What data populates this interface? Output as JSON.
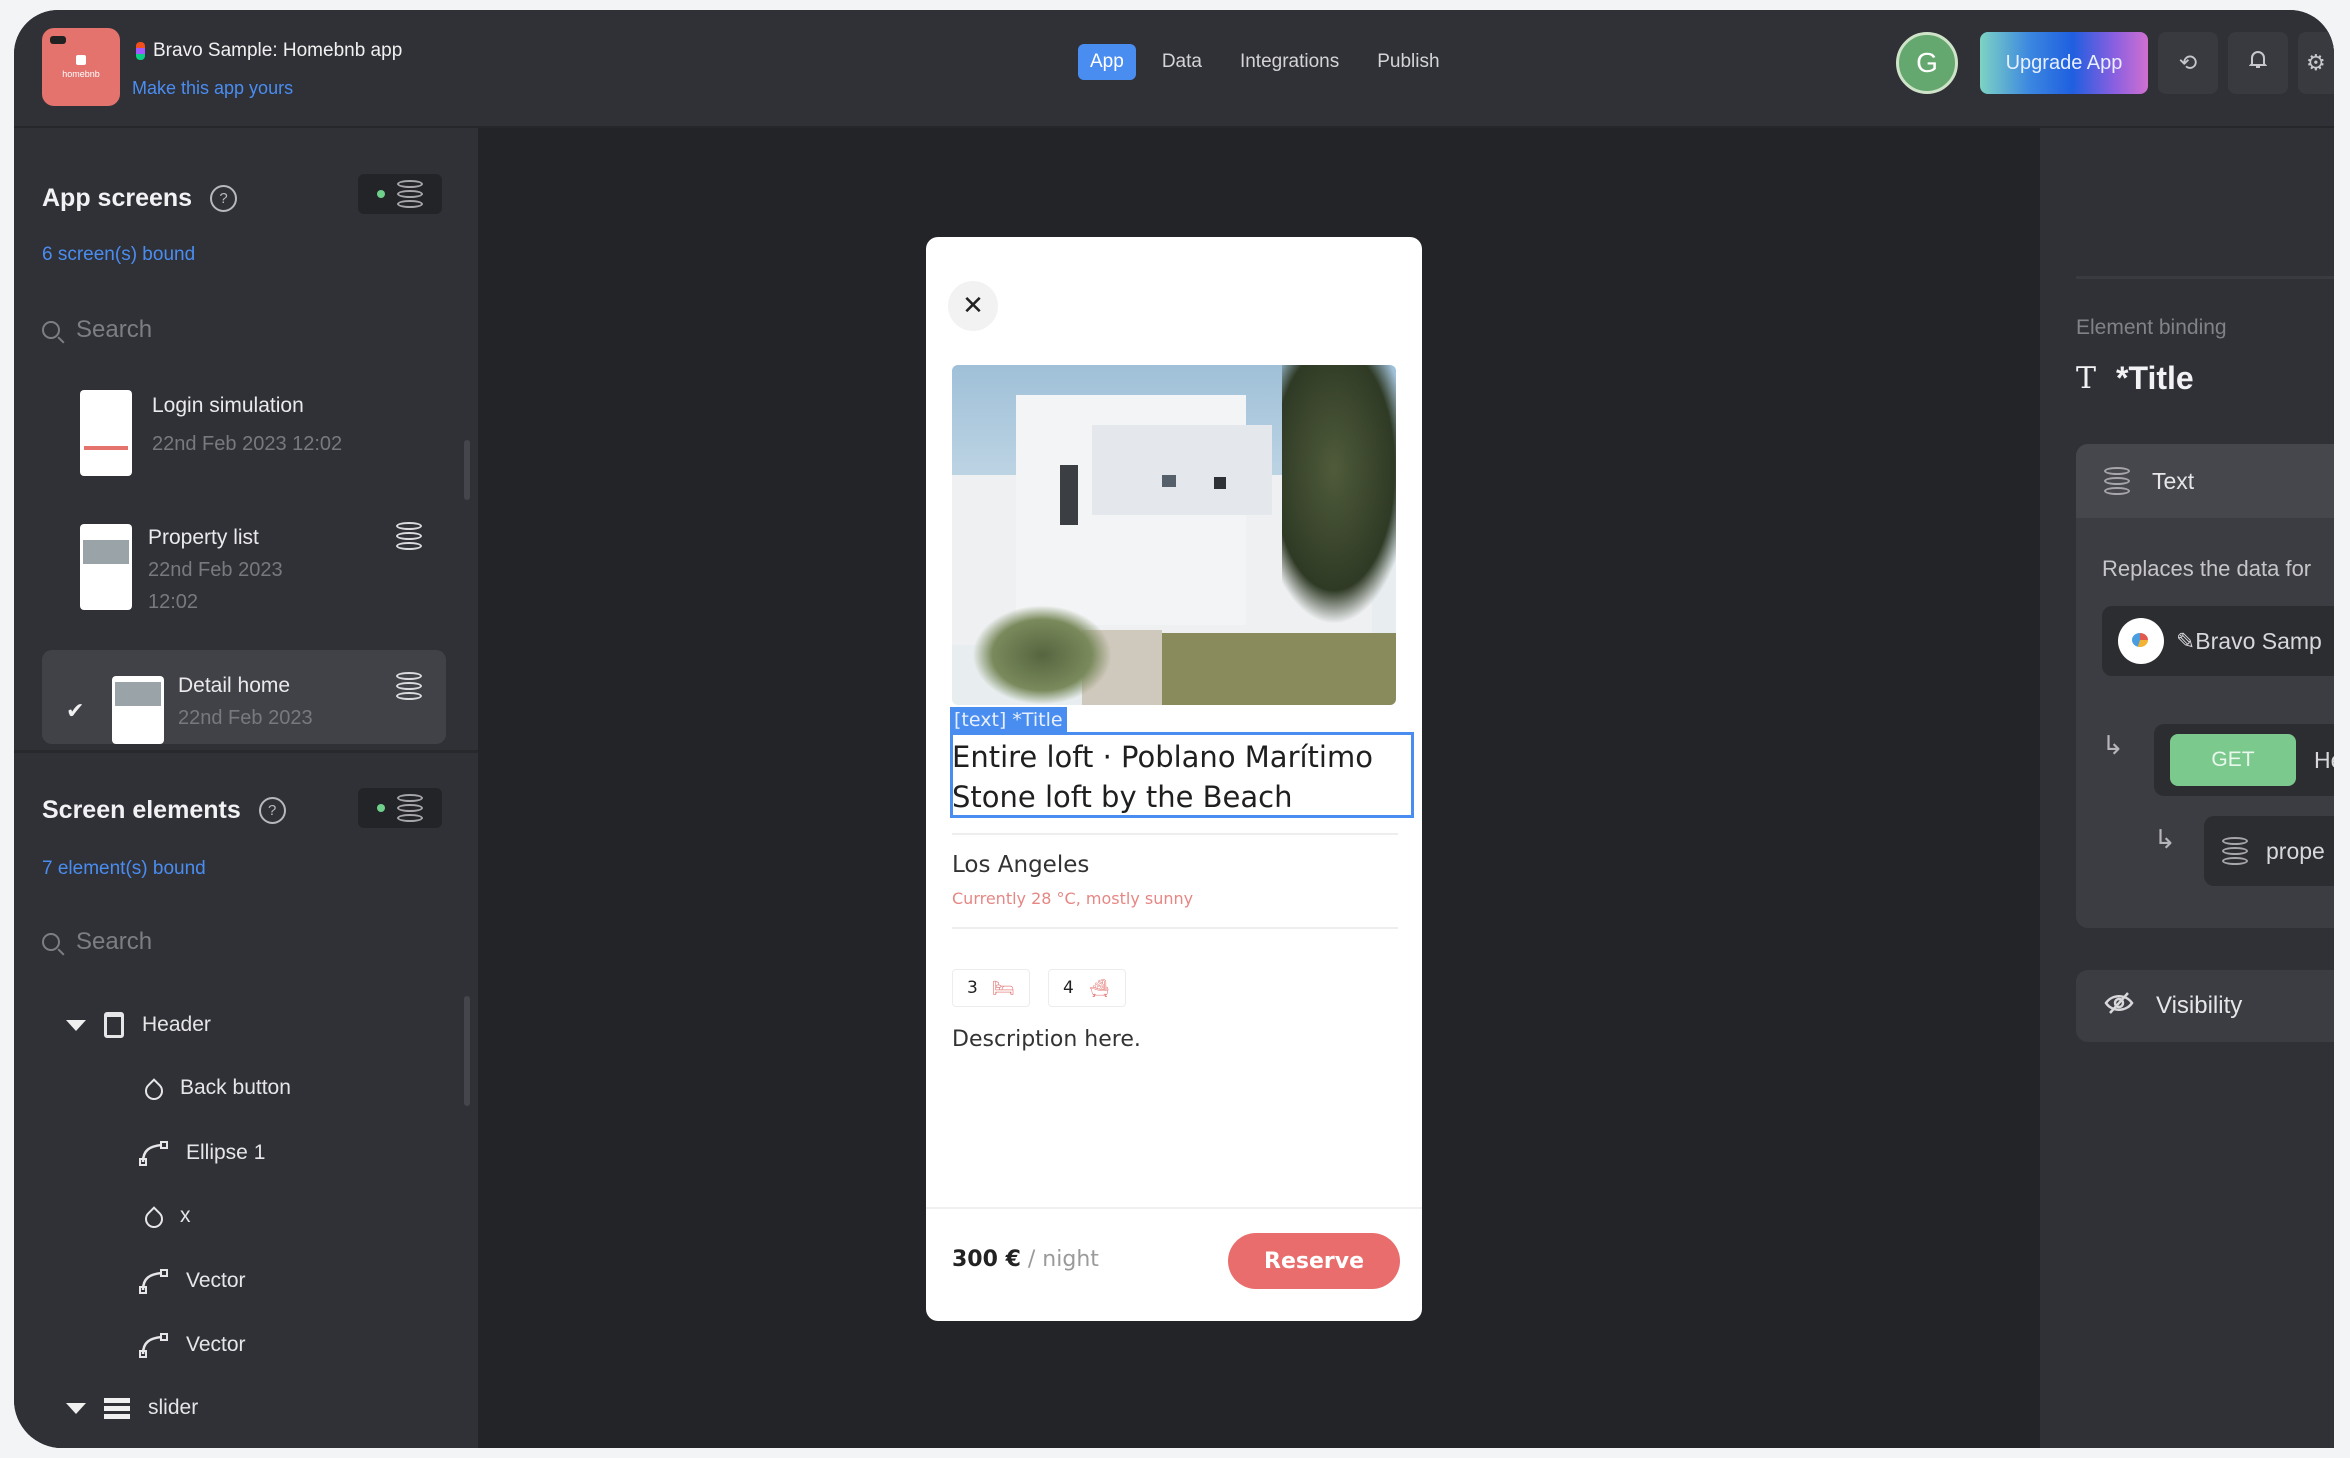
{
  "header": {
    "app_logo_text": "homebnb",
    "app_title": "Bravo Sample: Homebnb app",
    "app_subtitle": "Make this app yours",
    "nav_tabs": [
      {
        "label": "App",
        "active": true
      },
      {
        "label": "Data",
        "active": false
      },
      {
        "label": "Integrations",
        "active": false
      },
      {
        "label": "Publish",
        "active": false
      }
    ],
    "avatar_initial": "G",
    "upgrade_label": "Upgrade App",
    "icons": [
      "sync-icon",
      "bell-icon",
      "settings-icon"
    ]
  },
  "app_screens": {
    "title": "App screens",
    "bound_text": "6 screen(s) bound",
    "search_placeholder": "Search",
    "items": [
      {
        "name": "Login simulation",
        "date": "22nd Feb 2023 12:02",
        "bound": false,
        "selected": false
      },
      {
        "name": "Property list",
        "date_line1": "22nd Feb 2023",
        "date_line2": "12:02",
        "bound": true,
        "selected": false
      },
      {
        "name": "Detail home",
        "date": "22nd Feb 2023",
        "bound": true,
        "selected": true
      }
    ]
  },
  "screen_elements": {
    "title": "Screen elements",
    "bound_text": "7 element(s) bound",
    "search_placeholder": "Search",
    "tree": [
      {
        "label": "Header",
        "type": "frame",
        "expanded": true,
        "level": 0
      },
      {
        "label": "Back button",
        "type": "component",
        "level": 1
      },
      {
        "label": "Ellipse 1",
        "type": "vector",
        "level": 1
      },
      {
        "label": "x",
        "type": "component",
        "level": 1
      },
      {
        "label": "Vector",
        "type": "vector",
        "level": 1
      },
      {
        "label": "Vector",
        "type": "vector",
        "level": 1
      },
      {
        "label": "slider",
        "type": "list",
        "expanded": true,
        "level": 0
      }
    ]
  },
  "canvas": {
    "close_symbol": "✕",
    "selection_tag": "[text] *Title",
    "title": "Entire loft · Poblano Marítimo Stone loft by the Beach",
    "city": "Los Angeles",
    "weather": "Currently 28 °C, mostly sunny",
    "bedrooms": "3",
    "bathrooms": "4",
    "description": "Description here.",
    "price": "300 €",
    "price_unit": "/ night",
    "reserve_label": "Reserve"
  },
  "binding_panel": {
    "section_label": "Element binding",
    "element_name": "*Title",
    "type_label": "Text",
    "description": "Replaces the data for",
    "source_name": "✎Bravo Samp",
    "method": "GET",
    "method_target": "He",
    "field": "prope",
    "visibility_label": "Visibility"
  },
  "colors": {
    "accent": "#4a8df0",
    "brand": "#e4736e",
    "reserve": "#ea6d6d",
    "get_badge": "#7cc98e",
    "status_dot": "#6fd08c"
  }
}
